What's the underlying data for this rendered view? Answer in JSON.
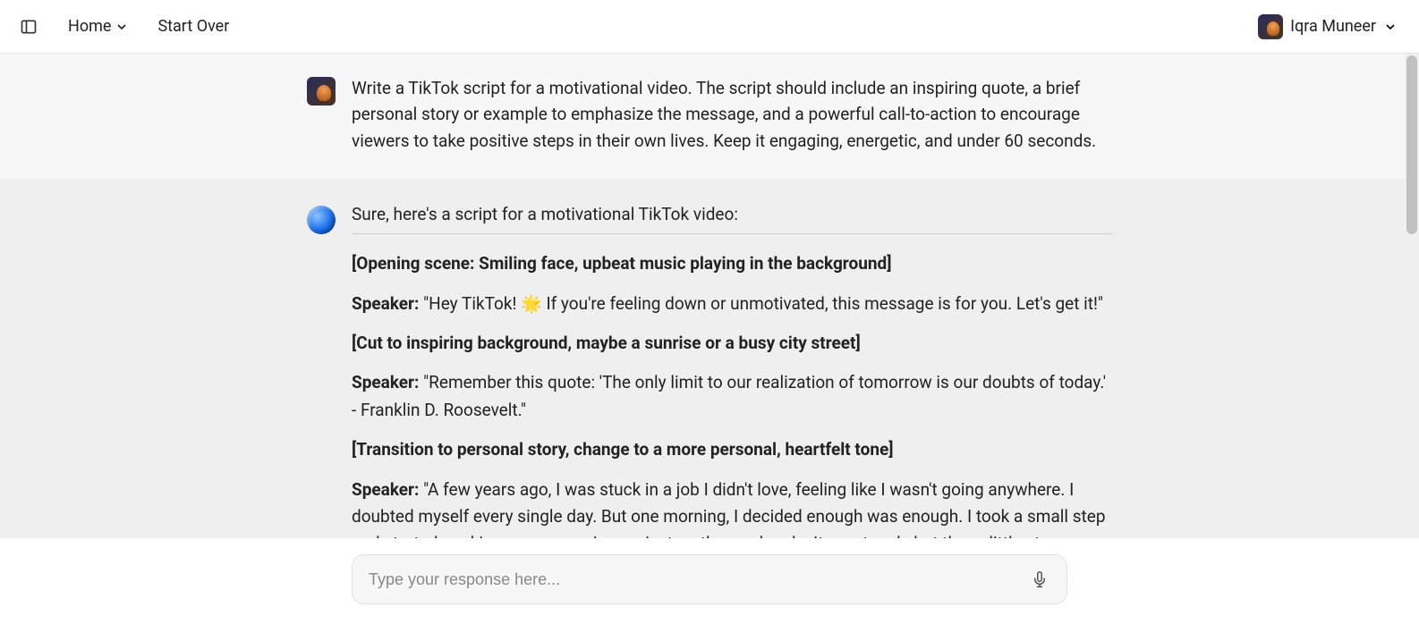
{
  "header": {
    "home_label": "Home",
    "start_over_label": "Start Over",
    "user_name": "Iqra Muneer"
  },
  "conversation": {
    "user_prompt": "Write a TikTok script for a motivational video. The script should include an inspiring quote, a brief personal story or example to emphasize the message, and a powerful call-to-action to encourage viewers to take positive steps in their own lives. Keep it engaging, energetic, and under 60 seconds.",
    "assistant_intro": "Sure, here's a script for a motivational TikTok video:",
    "script": {
      "scene1": "[Opening scene: Smiling face, upbeat music playing in the background]",
      "line1_label": "Speaker:",
      "line1_text": " \"Hey TikTok! 🌟 If you're feeling down or unmotivated, this message is for you. Let's get it!\"",
      "scene2": "[Cut to inspiring background, maybe a sunrise or a busy city street]",
      "line2_label": "Speaker:",
      "line2_text": " \"Remember this quote: 'The only limit to our realization of tomorrow is our doubts of today.' - Franklin D. Roosevelt.\"",
      "scene3": "[Transition to personal story, change to a more personal, heartfelt tone]",
      "line3_label": "Speaker:",
      "line3_text": " \"A few years ago, I was stuck in a job I didn't love, feeling like I wasn't going anywhere. I doubted myself every single day. But one morning, I decided enough was enough. I took a small step and started working on my passion project on the weekends. It was tough, but those little steps turned into big strides. Fast forward to today, I'm living my dream, doing what I love!\""
    }
  },
  "input": {
    "placeholder": "Type your response here..."
  }
}
